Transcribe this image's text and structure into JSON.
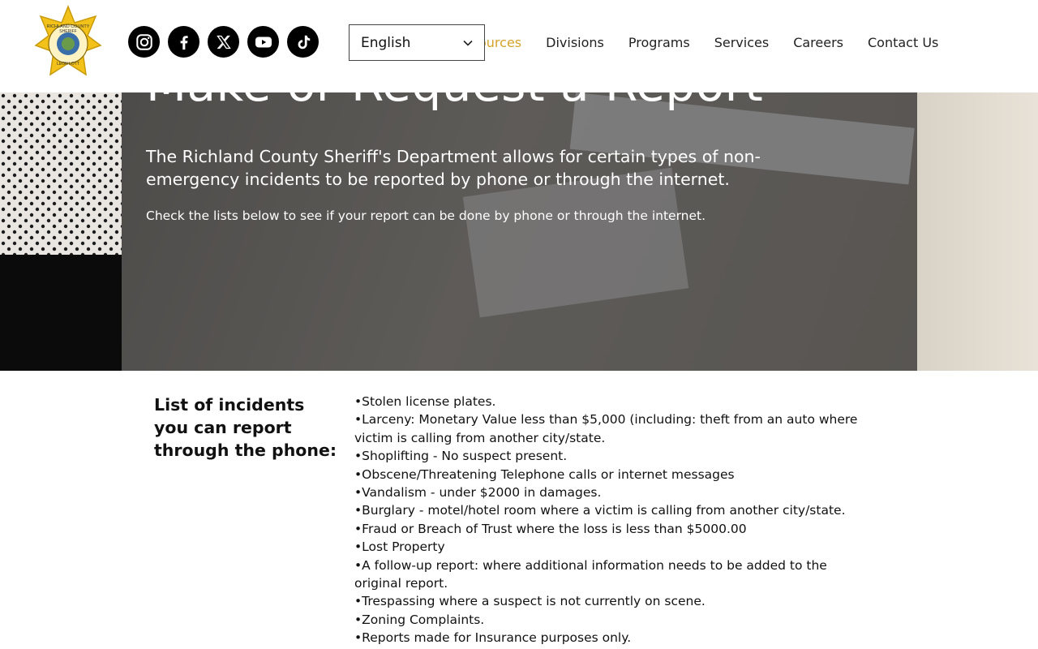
{
  "header": {
    "logo_text": [
      "RICHLAND COUNTY",
      "SHERIFF",
      "STATE OF SOUTH CAROLINA",
      "LEON LOTT"
    ],
    "social": [
      {
        "name": "instagram-icon"
      },
      {
        "name": "facebook-icon"
      },
      {
        "name": "x-icon"
      },
      {
        "name": "youtube-icon"
      },
      {
        "name": "tiktok-icon"
      }
    ],
    "language_select": {
      "selected": "English"
    },
    "nav": [
      {
        "label": "ources",
        "active": true
      },
      {
        "label": "Divisions"
      },
      {
        "label": "Programs"
      },
      {
        "label": "Services"
      },
      {
        "label": "Careers"
      },
      {
        "label": "Contact Us"
      }
    ],
    "accent_color": "#d4a32a"
  },
  "hero": {
    "title": "Make or Request a Report",
    "subtitle": "The Richland County Sheriff's Department allows for certain types of non-emergency incidents to be reported by phone or through the internet.",
    "note": "Check the lists below to see if your report can be done by phone or through the internet."
  },
  "phone_section": {
    "heading": "List of incidents you can report through the phone:",
    "items": [
      "Stolen license plates.",
      "Larceny: Monetary Value less than $5,000 (including: theft from an auto where victim is calling from another city/state.",
      "Shoplifting - No suspect present.",
      "Obscene/Threatening Telephone calls or internet messages",
      "Vandalism - under $2000 in damages.",
      "Burglary - motel/hotel room where a victim is calling from another city/state.",
      "Fraud or Breach of Trust where the loss is less than $5000.00",
      "Lost Property",
      "A follow-up report: where additional information needs to be added to the original report.",
      "Trespassing where a suspect is not currently on scene.",
      "Zoning Complaints.",
      "Reports made for Insurance purposes only."
    ]
  }
}
